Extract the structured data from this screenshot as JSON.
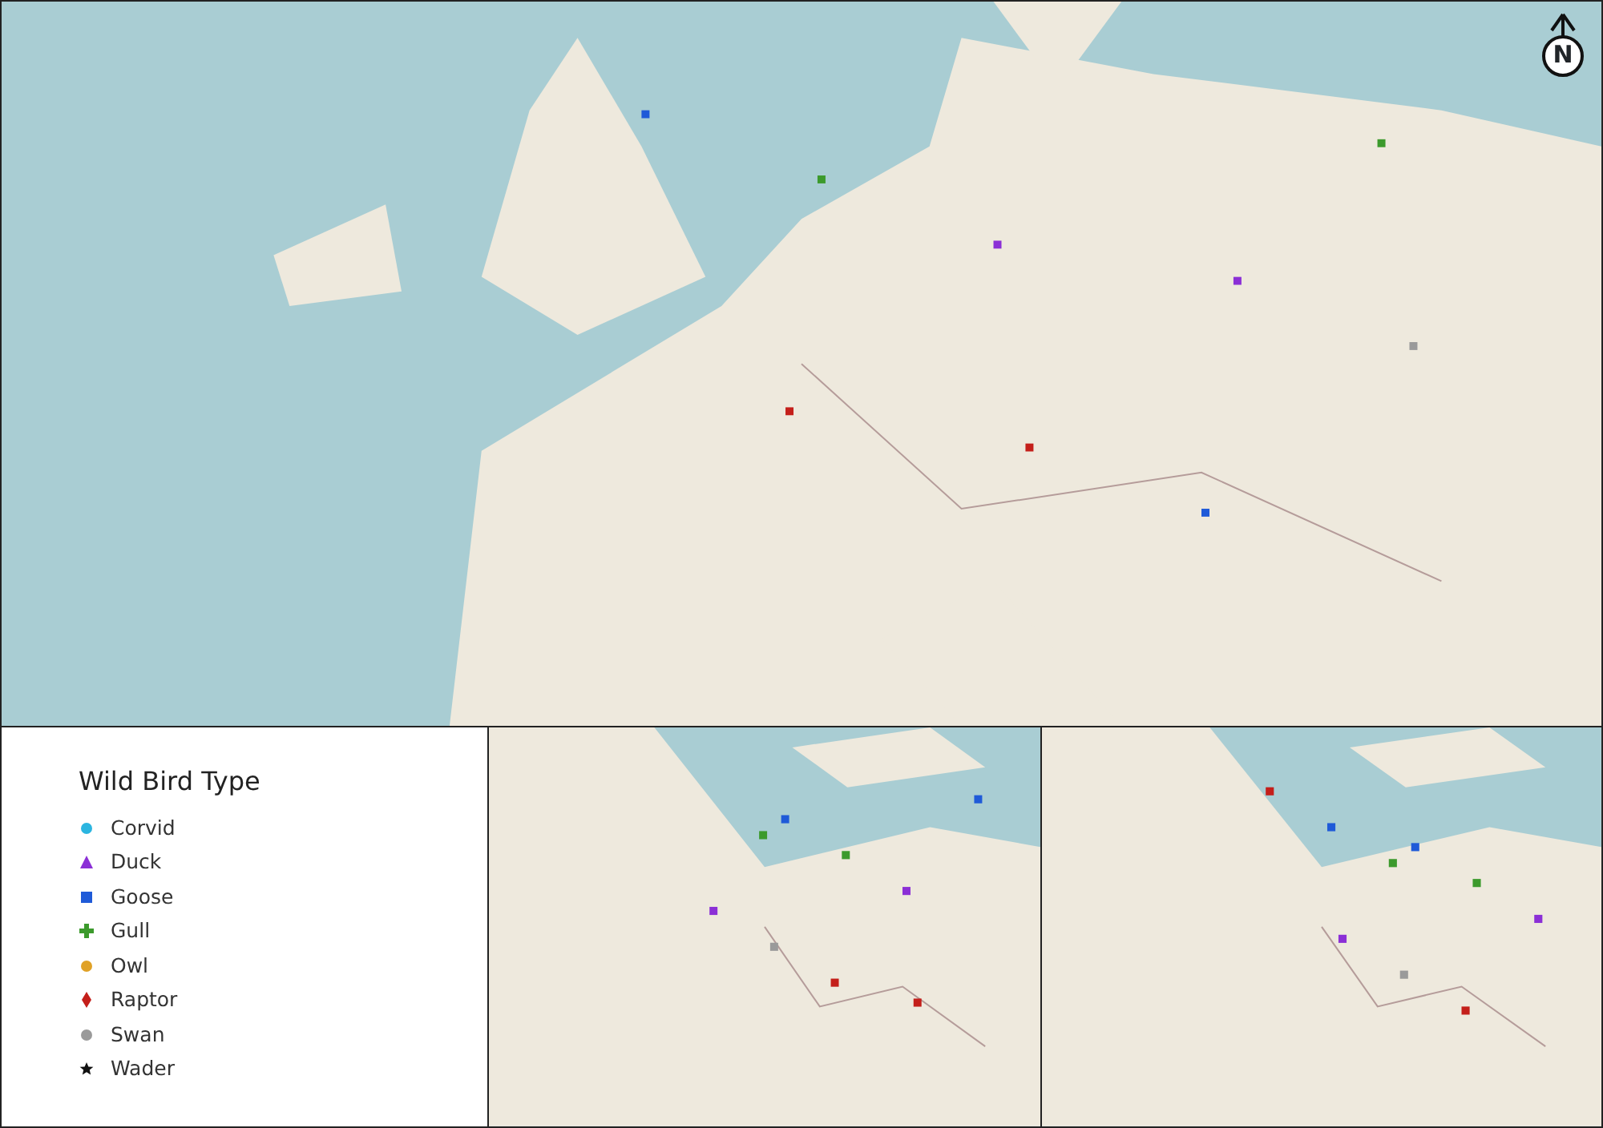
{
  "north_arrow": {
    "label": "N"
  },
  "legend": {
    "title": "Wild Bird Type",
    "items": [
      {
        "label": "Corvid",
        "kind": "circle",
        "color": "#2bb5e0"
      },
      {
        "label": "Duck",
        "kind": "triangle",
        "color": "#8b2fd6"
      },
      {
        "label": "Goose",
        "kind": "square",
        "color": "#1f5ad8"
      },
      {
        "label": "Gull",
        "kind": "plus",
        "color": "#3c9a2c"
      },
      {
        "label": "Owl",
        "kind": "circle",
        "color": "#e0a126"
      },
      {
        "label": "Raptor",
        "kind": "diamond",
        "color": "#c41f1a"
      },
      {
        "label": "Swan",
        "kind": "circle",
        "color": "#9a9a9a"
      },
      {
        "label": "Wader",
        "kind": "star",
        "color": "#111111"
      }
    ]
  }
}
